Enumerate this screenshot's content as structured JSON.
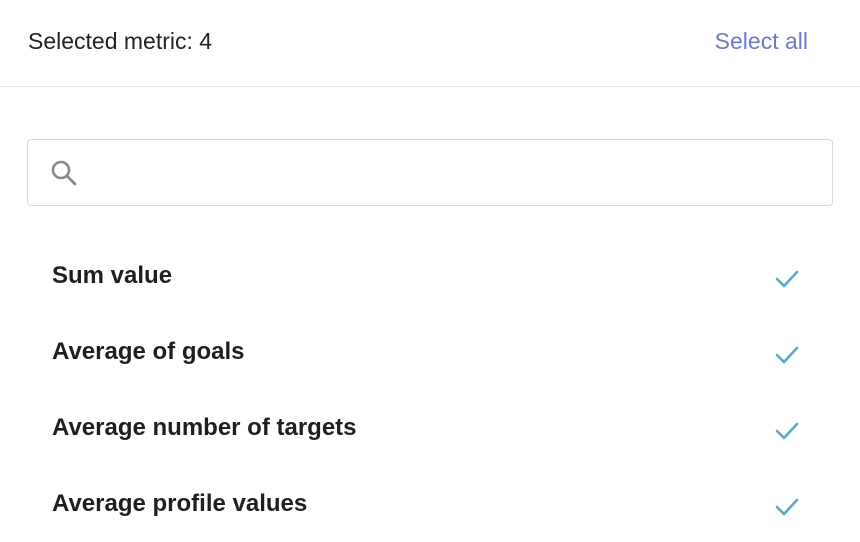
{
  "header": {
    "selected_label": "Selected metric: 4",
    "select_all_label": "Select all"
  },
  "search": {
    "icon": "search-icon",
    "value": "",
    "placeholder": ""
  },
  "metrics": [
    {
      "label": "Sum value",
      "selected": true,
      "icon": "check-icon"
    },
    {
      "label": "Average of goals",
      "selected": true,
      "icon": "check-icon"
    },
    {
      "label": "Average number of targets",
      "selected": true,
      "icon": "check-icon"
    },
    {
      "label": "Average profile values",
      "selected": true,
      "icon": "check-icon"
    }
  ],
  "colors": {
    "accent": "#6f79c9",
    "check": "#5aa8c8",
    "text": "#1f1f1f",
    "divider": "#e4e4e4"
  }
}
